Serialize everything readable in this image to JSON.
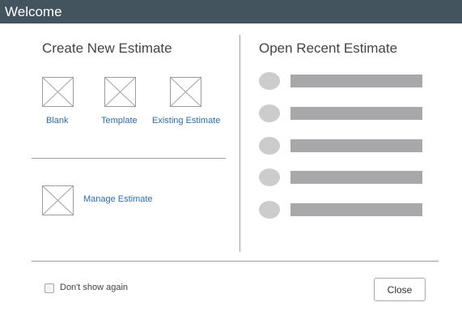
{
  "window": {
    "title": "Welcome"
  },
  "create_new": {
    "title": "Create New Estimate",
    "options": [
      {
        "label": "Blank"
      },
      {
        "label": "Template"
      },
      {
        "label": "Existing Estimate"
      }
    ],
    "manage_label": "Manage Estimate"
  },
  "open_recent": {
    "title": "Open Recent Estimate",
    "item_count": 5
  },
  "footer": {
    "dont_show_label": "Don't show again",
    "dont_show_checked": false,
    "close_label": "Close"
  },
  "colors": {
    "titlebar": "#44545f",
    "link": "#2a6db2",
    "placeholder_bar": "#a8a8ab",
    "placeholder_dot": "#cccccc"
  }
}
